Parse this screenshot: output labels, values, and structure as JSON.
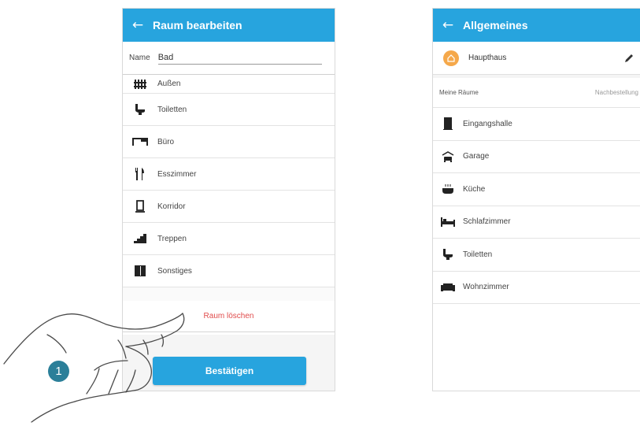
{
  "left_screen": {
    "back_icon": "arrow-left-icon",
    "title": "Raum bearbeiten",
    "name_label": "Name",
    "name_value": "Bad",
    "room_types": [
      {
        "label": "Außen",
        "icon": "fence-icon"
      },
      {
        "label": "Toiletten",
        "icon": "toilet-icon"
      },
      {
        "label": "Büro",
        "icon": "desk-icon"
      },
      {
        "label": "Esszimmer",
        "icon": "cutlery-icon"
      },
      {
        "label": "Korridor",
        "icon": "lamp-icon"
      },
      {
        "label": "Treppen",
        "icon": "stairs-icon"
      },
      {
        "label": "Sonstiges",
        "icon": "other-room-icon"
      }
    ],
    "delete_label": "Raum löschen",
    "confirm_label": "Bestätigen"
  },
  "right_screen": {
    "back_icon": "arrow-left-icon",
    "title": "Allgemeines",
    "house_name": "Haupthaus",
    "section_title": "Meine Räume",
    "reorder_label": "Nachbestellung",
    "rooms": [
      {
        "label": "Eingangshalle",
        "icon": "door-icon"
      },
      {
        "label": "Garage",
        "icon": "garage-icon"
      },
      {
        "label": "Küche",
        "icon": "cooking-pot-icon"
      },
      {
        "label": "Schlafzimmer",
        "icon": "bed-icon"
      },
      {
        "label": "Toiletten",
        "icon": "toilet-icon"
      },
      {
        "label": "Wohnzimmer",
        "icon": "sofa-icon"
      }
    ]
  },
  "step_number": "1",
  "colors": {
    "accent": "#27a4de",
    "danger": "#e04b4b",
    "house_badge": "#f5a84a",
    "step_badge": "#2b7f99"
  }
}
